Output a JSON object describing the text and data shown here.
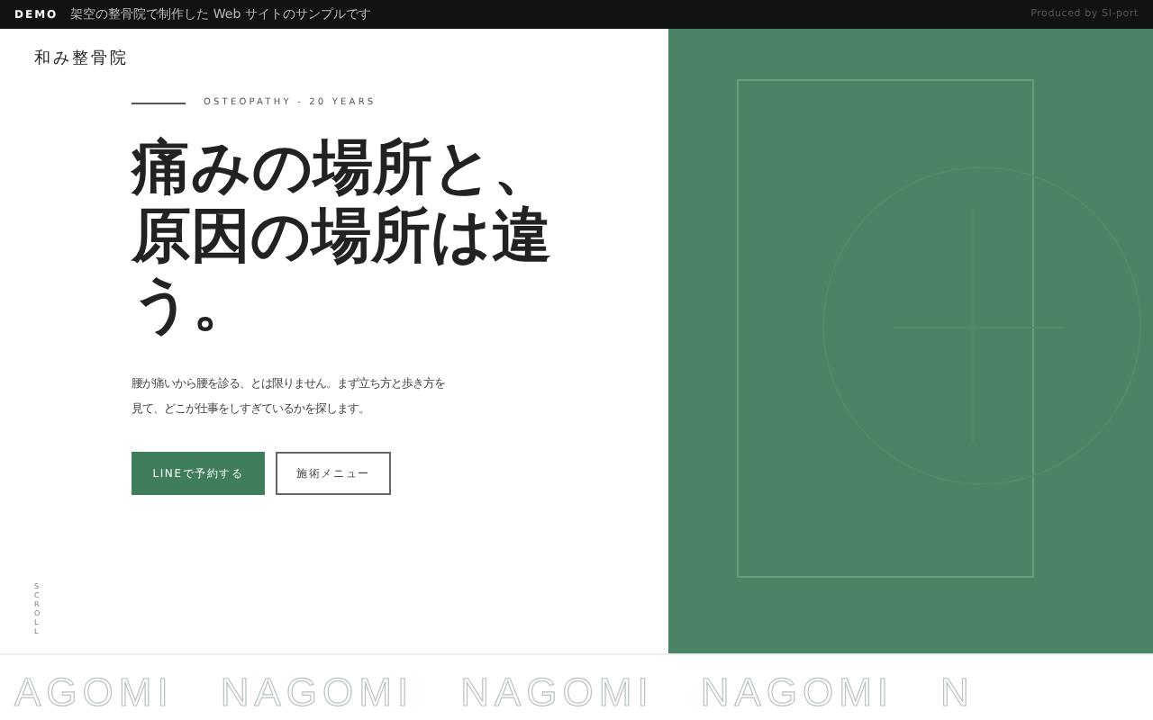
{
  "demo_bar": {
    "badge": "DEMO",
    "note": "架空の整骨院で制作した Web サイトのサンプルです",
    "credit": "Produced by SI-port"
  },
  "header": {
    "logo": "和み整骨院"
  },
  "hero": {
    "eyebrow": "OSTEOPATHY - 20 YEARS",
    "headline": "痛みの場所と、原因の場所は違う。",
    "lead": "腰が痛いから腰を診る、とは限りません。まず立ち方と歩き方を見て、どこが仕事をしすぎているかを探します。",
    "buttons": [
      {
        "label": "LINEで予約する",
        "kind": "primary"
      },
      {
        "label": "施術メニュー",
        "kind": "outline"
      }
    ],
    "scroll_hint": "SCROLL"
  },
  "marquee": [
    "AGOMI",
    "NAGOMI",
    "NAGOMI",
    "NAGOMI",
    "N"
  ]
}
